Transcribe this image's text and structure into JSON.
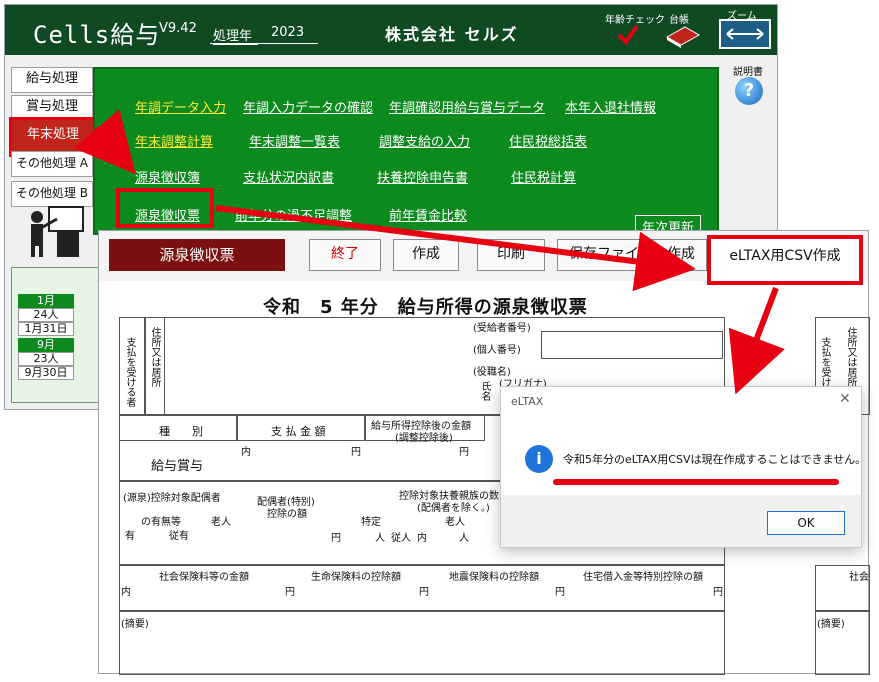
{
  "app": {
    "title": "Cells給与",
    "version": "V9.42",
    "year_label": "処理年",
    "year_value": "2023",
    "company": "株式会社 セルズ",
    "age_check_label": "年齢チェック",
    "ledger_label": "台帳",
    "zoom_label": "ズーム",
    "manual_label": "説明書"
  },
  "sidebar": {
    "items": [
      {
        "label": "給与処理"
      },
      {
        "label": "賞与処理"
      },
      {
        "label": "年末処理"
      },
      {
        "label": "その他処理 A"
      },
      {
        "label": "その他処理 B"
      }
    ]
  },
  "menu": {
    "row1": [
      "年調データ入力",
      "年調入力データの確認",
      "年調確認用給与賞与データ",
      "本年入退社情報"
    ],
    "row2": [
      "年末調整計算",
      "年末調整一覧表",
      "調整支給の入力",
      "住民税総括表"
    ],
    "row3": [
      "源泉徴収簿",
      "支払状況内訳書",
      "扶養控除申告書",
      "住民税計算"
    ],
    "row4": [
      "源泉徴収票",
      "前年分の過不足調整",
      "前年賃金比較"
    ],
    "yearly_update": "年次更新"
  },
  "calendar": {
    "month1": "1月",
    "count1": "24人",
    "date1": "1月31日",
    "month2": "9月",
    "count2": "23人",
    "date2": "9月30日"
  },
  "form_window": {
    "title": "源泉徴収票",
    "buttons": {
      "exit": "終了",
      "create": "作成",
      "print": "印刷",
      "save": "保存ファイルの作成",
      "eltax": "eLTAX用CSV作成"
    },
    "doc_title": "令和　5 年分　給与所得の源泉徴収票",
    "labels": {
      "payer": "支払を受ける者",
      "address": "住所又は居所",
      "recipient_no": "(受給者番号)",
      "personal_no": "(個人番号)",
      "position": "(役職名)",
      "furigana": "(フリガナ)",
      "name": "氏名",
      "type": "種　　別",
      "payment_amount": "支 払 金 額",
      "after_deduction": "給与所得控除後の金額",
      "after_deduction_sub": "(調整控除後)",
      "salary_bonus": "給与賞与",
      "yen": "円",
      "inner": "内",
      "spouse_header": "(源泉)控除対象配偶者",
      "spouse_exists": "の有無等",
      "elderly": "老人",
      "spouse_deduction": "配偶者(特別)",
      "spouse_deduction2": "控除の額",
      "dependents": "控除対象扶養親族の数",
      "dependents_sub": "(配偶者を除く。)",
      "specific": "特定",
      "elderly2": "老人",
      "yes": "有",
      "dependent_yes": "従有",
      "person": "人",
      "subordinate": "従人",
      "social_insurance": "社会保険料等の金額",
      "life_insurance": "生命保険料の控除額",
      "earthquake": "地震保険料の控除額",
      "housing": "住宅借入金等特別控除の額",
      "remarks": "(摘要)",
      "payer_r": "支払を受ける者",
      "address_r": "住所又は居所",
      "social_r": "社会",
      "remarks_r": "(摘要)"
    }
  },
  "dialog": {
    "title": "eLTAX",
    "message": "令和5年分のeLTAX用CSVは現在作成することはできません。",
    "ok": "OK",
    "close": "✕"
  },
  "colors": {
    "header_green": "#0f4a22",
    "menu_green": "#0d8a1d",
    "highlight_red": "#e60012",
    "form_title": "#7a1010"
  }
}
